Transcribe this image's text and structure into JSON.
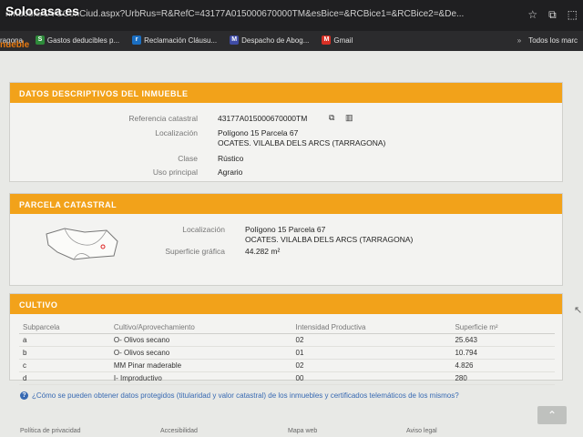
{
  "browser": {
    "watermark": "Solocasa.es",
    "url": "nmueble/OVCConCiud.aspx?UrbRus=R&RefC=43177A015000670000TM&esBice=&RCBice1=&RCBice2=&De...",
    "bookmarks": [
      {
        "label": "ragona",
        "icon": "",
        "color": "#2b2b2d"
      },
      {
        "label": "Gastos deducibles p...",
        "icon": "S",
        "color": "#2e8b3a"
      },
      {
        "label": "Reclamación Cláusu...",
        "icon": "r",
        "color": "#1b6fc2"
      },
      {
        "label": "Despacho de Abog...",
        "icon": "M",
        "color": "#3f4ca6"
      },
      {
        "label": "Gmail",
        "icon": "M",
        "color": "#d93025"
      }
    ],
    "more": "»",
    "all_bookmarks": "Todos los marc"
  },
  "page": {
    "tab_label": "nueble",
    "descriptive": {
      "title": "DATOS DESCRIPTIVOS DEL INMUEBLE",
      "ref_label": "Referencia catastral",
      "ref_value": "43177A015000670000TM",
      "loc_label": "Localización",
      "loc_line1": "Polígono 15 Parcela 67",
      "loc_line2": "OCATES. VILALBA DELS ARCS (TARRAGONA)",
      "clase_label": "Clase",
      "clase_value": "Rústico",
      "uso_label": "Uso principal",
      "uso_value": "Agrario"
    },
    "parcela": {
      "title": "PARCELA CATASTRAL",
      "loc_label": "Localización",
      "loc_line1": "Polígono 15 Parcela 67",
      "loc_line2": "OCATES. VILALBA DELS ARCS (TARRAGONA)",
      "sup_label": "Superficie gráfica",
      "sup_value": "44.282 m²"
    },
    "cultivo": {
      "title": "CULTIVO",
      "headers": [
        "Subparcela",
        "Cultivo/Aprovechamiento",
        "Intensidad Productiva",
        "Superficie m²"
      ],
      "rows": [
        [
          "a",
          "O- Olivos secano",
          "02",
          "25.643"
        ],
        [
          "b",
          "O- Olivos secano",
          "01",
          "10.794"
        ],
        [
          "c",
          "MM Pinar maderable",
          "02",
          "4.826"
        ],
        [
          "d",
          "I- Improductivo",
          "00",
          "280"
        ]
      ]
    },
    "help_link": "¿Cómo se pueden obtener datos protegidos (titularidad y valor catastral) de los inmuebles y certificados telemáticos de los mismos?",
    "footer": [
      "Política de privacidad",
      "Accesibilidad",
      "Mapa web",
      "Aviso legal"
    ]
  }
}
